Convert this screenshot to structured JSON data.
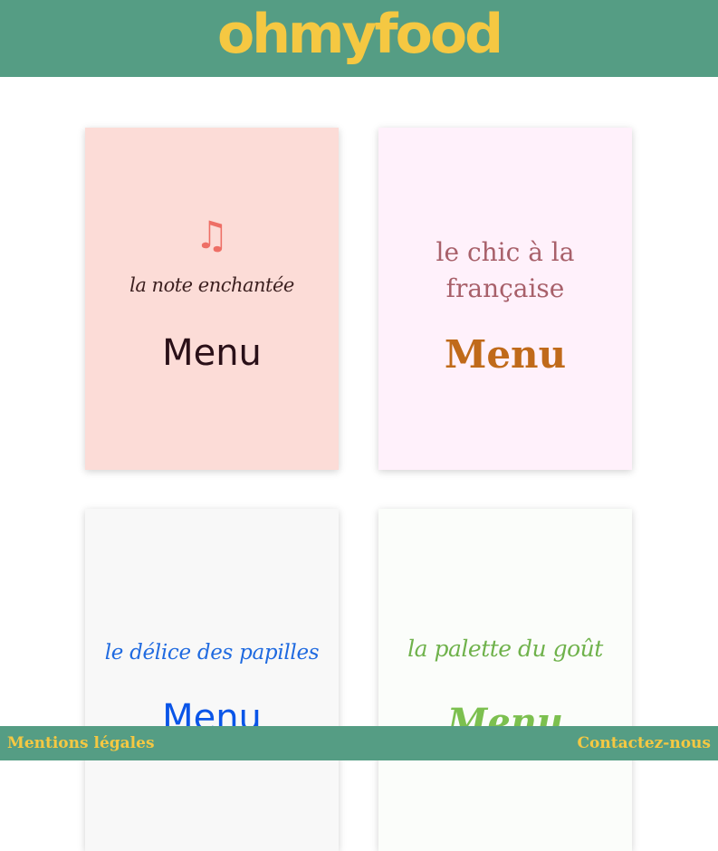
{
  "header": {
    "logo_text": "ohmyfood"
  },
  "cards": [
    {
      "icon": "music-note-icon",
      "icon_glyph": "♫",
      "title": "la note enchantée",
      "menu_label": "Menu"
    },
    {
      "title": "le chic à la française",
      "menu_label": "Menu"
    },
    {
      "title": "le délice des papilles",
      "menu_label": "Menu"
    },
    {
      "title": "la palette du goût",
      "menu_label": "Menu"
    }
  ],
  "footer": {
    "mentions_label": "Mentions légales",
    "contact_label": "Contactez-nous"
  },
  "colors": {
    "header_bg": "#559d84",
    "logo": "#f5c842",
    "card1_bg": "#fcdcd7",
    "card2_bg": "#fff1fb",
    "card3_bg": "#f8f8f8",
    "card4_bg": "#fbfdfa",
    "card2_menu": "#c06a1a",
    "card3_menu": "#0a55e8",
    "card4_menu": "#7cc04f"
  }
}
